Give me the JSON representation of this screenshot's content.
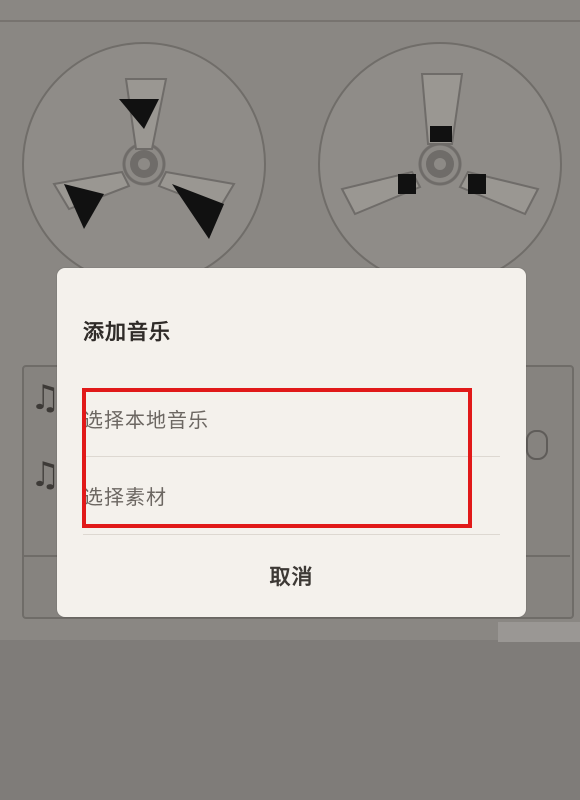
{
  "dialog": {
    "title": "添加音乐",
    "options": [
      {
        "label": "选择本地音乐"
      },
      {
        "label": "选择素材"
      }
    ],
    "cancel_label": "取消"
  },
  "background": {
    "note_icon_1": "music-note-icon",
    "note_icon_2": "music-note-icon"
  },
  "colors": {
    "highlight": "#e11919",
    "dialog_bg": "#f4f1ec"
  }
}
